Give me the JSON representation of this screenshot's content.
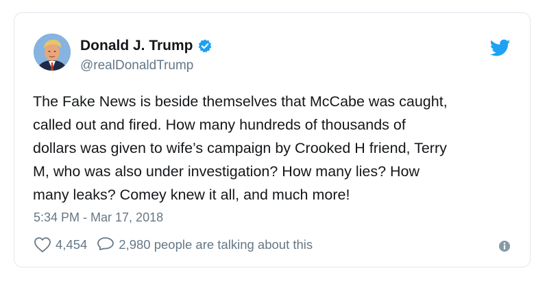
{
  "tweet": {
    "author": {
      "display_name": "Donald J. Trump",
      "handle": "@realDonaldTrump",
      "verified": true,
      "avatar_icon": "profile-photo"
    },
    "text": "The Fake News is beside themselves that McCabe was caught,\ncalled out and fired. How many hundreds of thousands of\ndollars was given to wife’s campaign by Crooked H friend, Terry\nM, who was also under investigation? How many lies? How\nmany leaks? Comey knew it all, and much more!",
    "timestamp": "5:34 PM - Mar 17, 2018",
    "likes": "4,454",
    "talking": "2,980 people are talking about this"
  },
  "icons": {
    "brand": "twitter-bird-icon",
    "verified": "verified-badge-icon",
    "like": "heart-icon",
    "reply": "speech-bubble-icon",
    "info": "info-icon"
  },
  "colors": {
    "brand_blue": "#1da1f2",
    "text_primary": "#14171a",
    "text_secondary": "#657786",
    "border": "#e1e8ed"
  }
}
